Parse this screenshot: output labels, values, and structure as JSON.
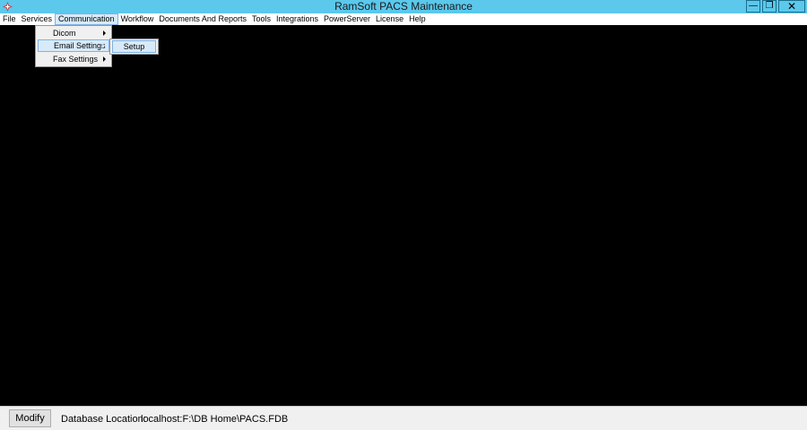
{
  "window": {
    "title": "RamSoft PACS Maintenance",
    "controls": {
      "minimize": "—",
      "maximize": "❐",
      "close": "✕"
    }
  },
  "menubar": {
    "items": [
      "File",
      "Services",
      "Communication",
      "Workflow",
      "Documents And Reports",
      "Tools",
      "Integrations",
      "PowerServer",
      "License",
      "Help"
    ],
    "active_index": 2
  },
  "communication_menu": {
    "items": [
      {
        "label": "Dicom",
        "has_submenu": true
      },
      {
        "label": "Email Settings",
        "has_submenu": true,
        "highlighted": true
      },
      {
        "label": "Fax Settings",
        "has_submenu": true
      }
    ]
  },
  "email_submenu": {
    "items": [
      "Setup"
    ]
  },
  "statusbar": {
    "modify_label": "Modify",
    "db_location_label": "Database Location:",
    "db_location_value": "localhost:F:\\DB Home\\PACS.FDB"
  },
  "colors": {
    "titlebar": "#5bc8ec",
    "workspace": "#000000",
    "highlight": "#d8eaf9",
    "highlight_border": "#7fb2e5"
  },
  "icons": {
    "app": "ramsoft-logo-icon"
  }
}
